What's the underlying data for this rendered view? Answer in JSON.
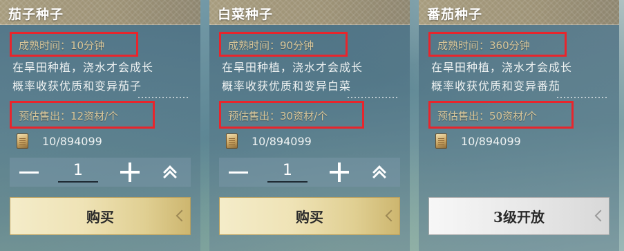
{
  "cards": [
    {
      "title": "茄子种子",
      "mature_time": "成熟时间：10分钟",
      "desc_line1": "在旱田种植，浇水才会成长",
      "desc_line2": "概率收获优质和变异茄子",
      "price": "预估售出：12资材/个",
      "stock": "10/894099",
      "quantity": "1",
      "button_label": "购买"
    },
    {
      "title": "白菜种子",
      "mature_time": "成熟时间：90分钟",
      "desc_line1": "在旱田种植，浇水才会成长",
      "desc_line2": "概率收获优质和变异白菜",
      "price": "预估售出：30资材/个",
      "stock": "10/894099",
      "quantity": "1",
      "button_label": "购买"
    },
    {
      "title": "番茄种子",
      "mature_time": "成熟时间：360分钟",
      "desc_line1": "在旱田种植，浇水才会成长",
      "desc_line2": "概率收获优质和变异番茄",
      "price": "预估售出：50资材/个",
      "stock": "10/894099",
      "button_label": "3级开放"
    }
  ],
  "colors": {
    "highlight_border": "#e8252c",
    "stat_text": "#d9c79a",
    "buy_button": "#efe3b6",
    "locked_button": "#e9e9e9"
  },
  "icons": {
    "stock": "coupon-icon",
    "decrease": "minus-icon",
    "increase": "plus-icon",
    "max": "double-chevron-up-icon"
  }
}
